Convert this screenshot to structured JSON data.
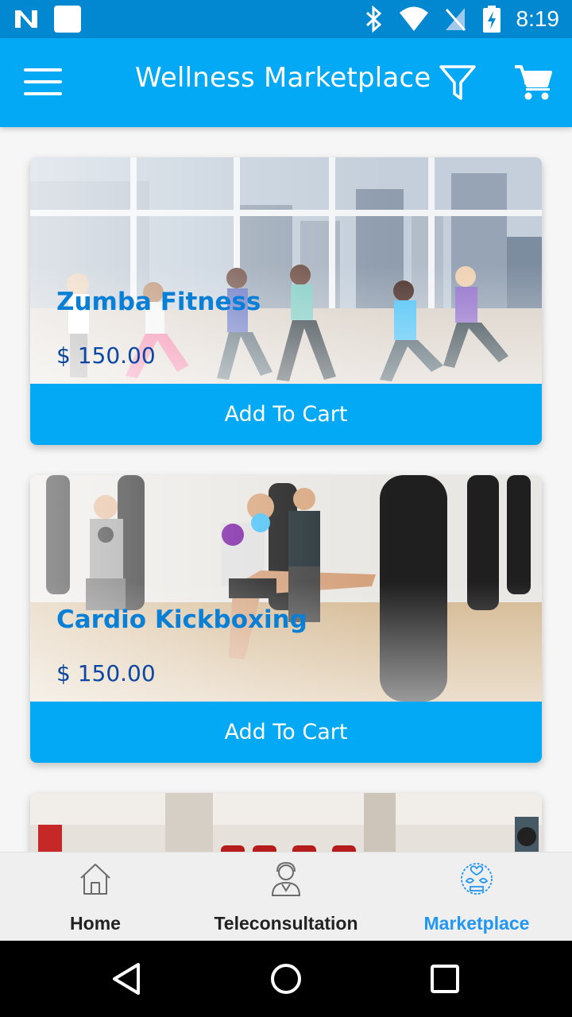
{
  "status_bar": {
    "time": "8:19"
  },
  "app_bar": {
    "title": "Wellness Marketplace"
  },
  "products": [
    {
      "title": "Zumba Fitness",
      "price": "$ 150.00",
      "button": "Add To Cart"
    },
    {
      "title": "Cardio Kickboxing",
      "price": "$ 150.00",
      "button": "Add To Cart"
    }
  ],
  "bottom_nav": {
    "items": [
      {
        "label": "Home",
        "icon": "home-icon"
      },
      {
        "label": "Teleconsultation",
        "icon": "doctor-icon"
      },
      {
        "label": "Marketplace",
        "icon": "marketplace-icon"
      }
    ],
    "active": "Marketplace"
  },
  "colors": {
    "status_bar": "#0288d1",
    "app_bar": "#03a9f4",
    "title_text": "#0a7fd6",
    "price_text": "#0d47a1",
    "active_nav": "#2196f3"
  }
}
